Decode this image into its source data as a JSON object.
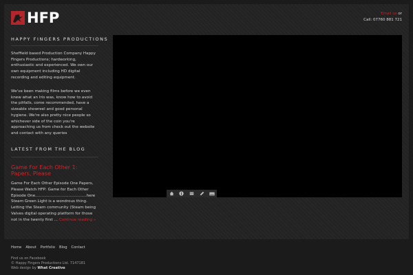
{
  "brand": {
    "logo_text": "HFP",
    "tagline": "HAPPY FINGERS PRODUCTIONS",
    "accent": "#b3262b"
  },
  "contact": {
    "link_text": "Email us",
    "link_suffix": " or",
    "phone": "Call: 07760 881 721"
  },
  "intro": {
    "p1": "Sheffield based Production Company Happy Fingers Productions; hardworking, enthusiastic and experienced. We own our own equipment including HD digital recording and editing equipment.",
    "p2": "We've been making films before we even knew what an Iris was, know how to avoid the pitfalls, come recommended, have a sizeable showreel and good personal hygiene. We're also pretty nice people so whichever side of the coin you're approaching us from check out the website and contact with any queries"
  },
  "blog": {
    "heading": "LATEST FROM THE BLOG",
    "post_title": "Game For Each Other 1: Papers, Please",
    "post_excerpt": "Game For Each Other Episode One Papers, Please Watch HFP: Game for Each Other Episode One………………………………….here Steam Green Light is a wondrous thing. Letting the Steam community (Steam being Valves digital operating platform for those not in the twenty first …",
    "more_label": "Continue reading »"
  },
  "video_controls": {
    "icons": [
      "home-icon",
      "info-icon",
      "film-icon",
      "edit-icon",
      "keyboard-icon"
    ]
  },
  "footer": {
    "nav": [
      "Home",
      "About",
      "Portfolio",
      "Blog",
      "Contact"
    ],
    "facebook": "Find us on Facebook",
    "copyright": "© Happy Fingers Productions Ltd. 7147181",
    "credit_prefix": "Web design by ",
    "credit_name": "What Creative"
  }
}
